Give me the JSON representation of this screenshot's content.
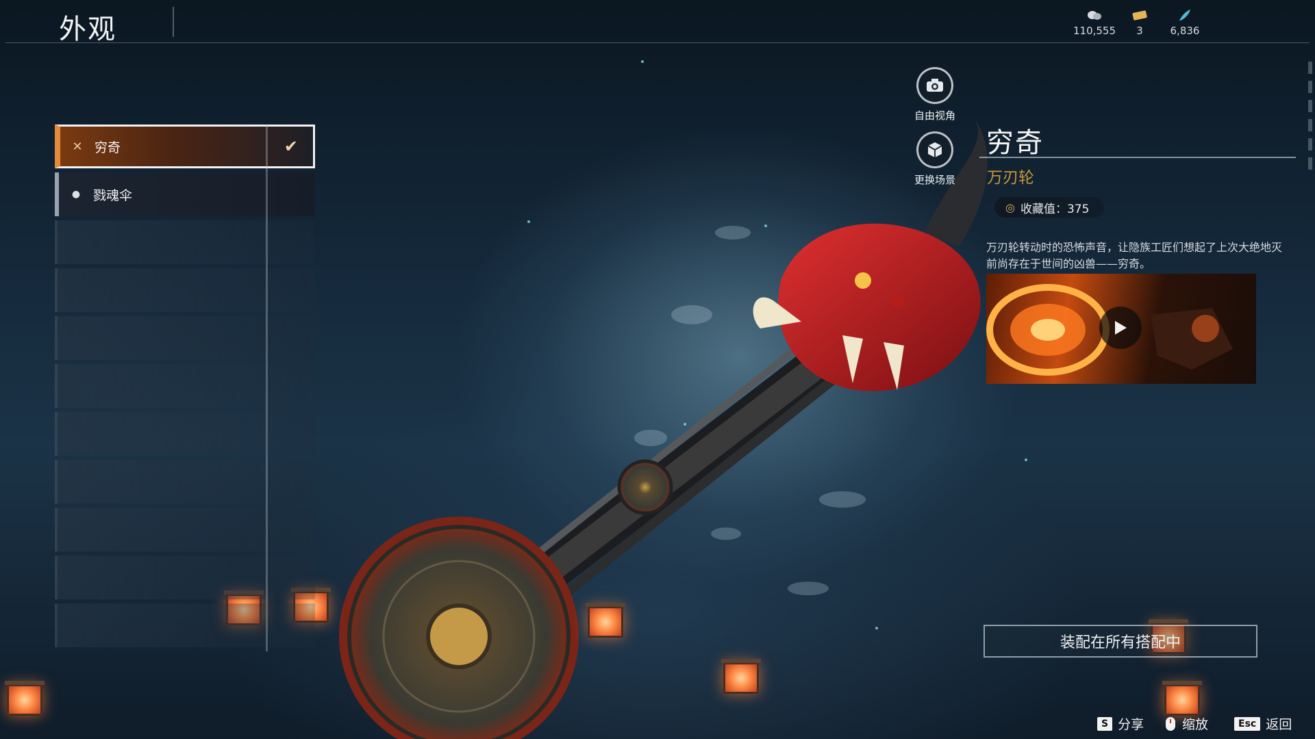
{
  "header": {
    "title": "外观",
    "currencies": [
      {
        "icon": "coin-stack-icon",
        "value": "110,555"
      },
      {
        "icon": "ticket-icon",
        "value": "3"
      },
      {
        "icon": "feather-icon",
        "value": "6,836"
      }
    ]
  },
  "skin_list": {
    "items": [
      {
        "label": "穷奇",
        "icon": "blade-cross-icon",
        "selected": true
      },
      {
        "label": "戮魂伞",
        "icon": "drop-icon",
        "selected": false
      }
    ]
  },
  "side_buttons": {
    "free_view": "自由视角",
    "change_scene": "更换场景"
  },
  "detail": {
    "name": "穷奇",
    "type": "万刃轮",
    "collection_label": "收藏值：375",
    "description": "万刃轮转动时的恐怖声音，让隐族工匠们想起了上次大绝地灭前尚存在于世间的凶兽——穷奇。",
    "equip_button": "装配在所有搭配中"
  },
  "hints": [
    {
      "key": "S",
      "label": "分享"
    },
    {
      "key": "",
      "label": "缩放"
    },
    {
      "key": "Esc",
      "label": "返回"
    }
  ],
  "colors": {
    "accent_orange": "#e38a3b",
    "gold_text": "#c9963c"
  }
}
